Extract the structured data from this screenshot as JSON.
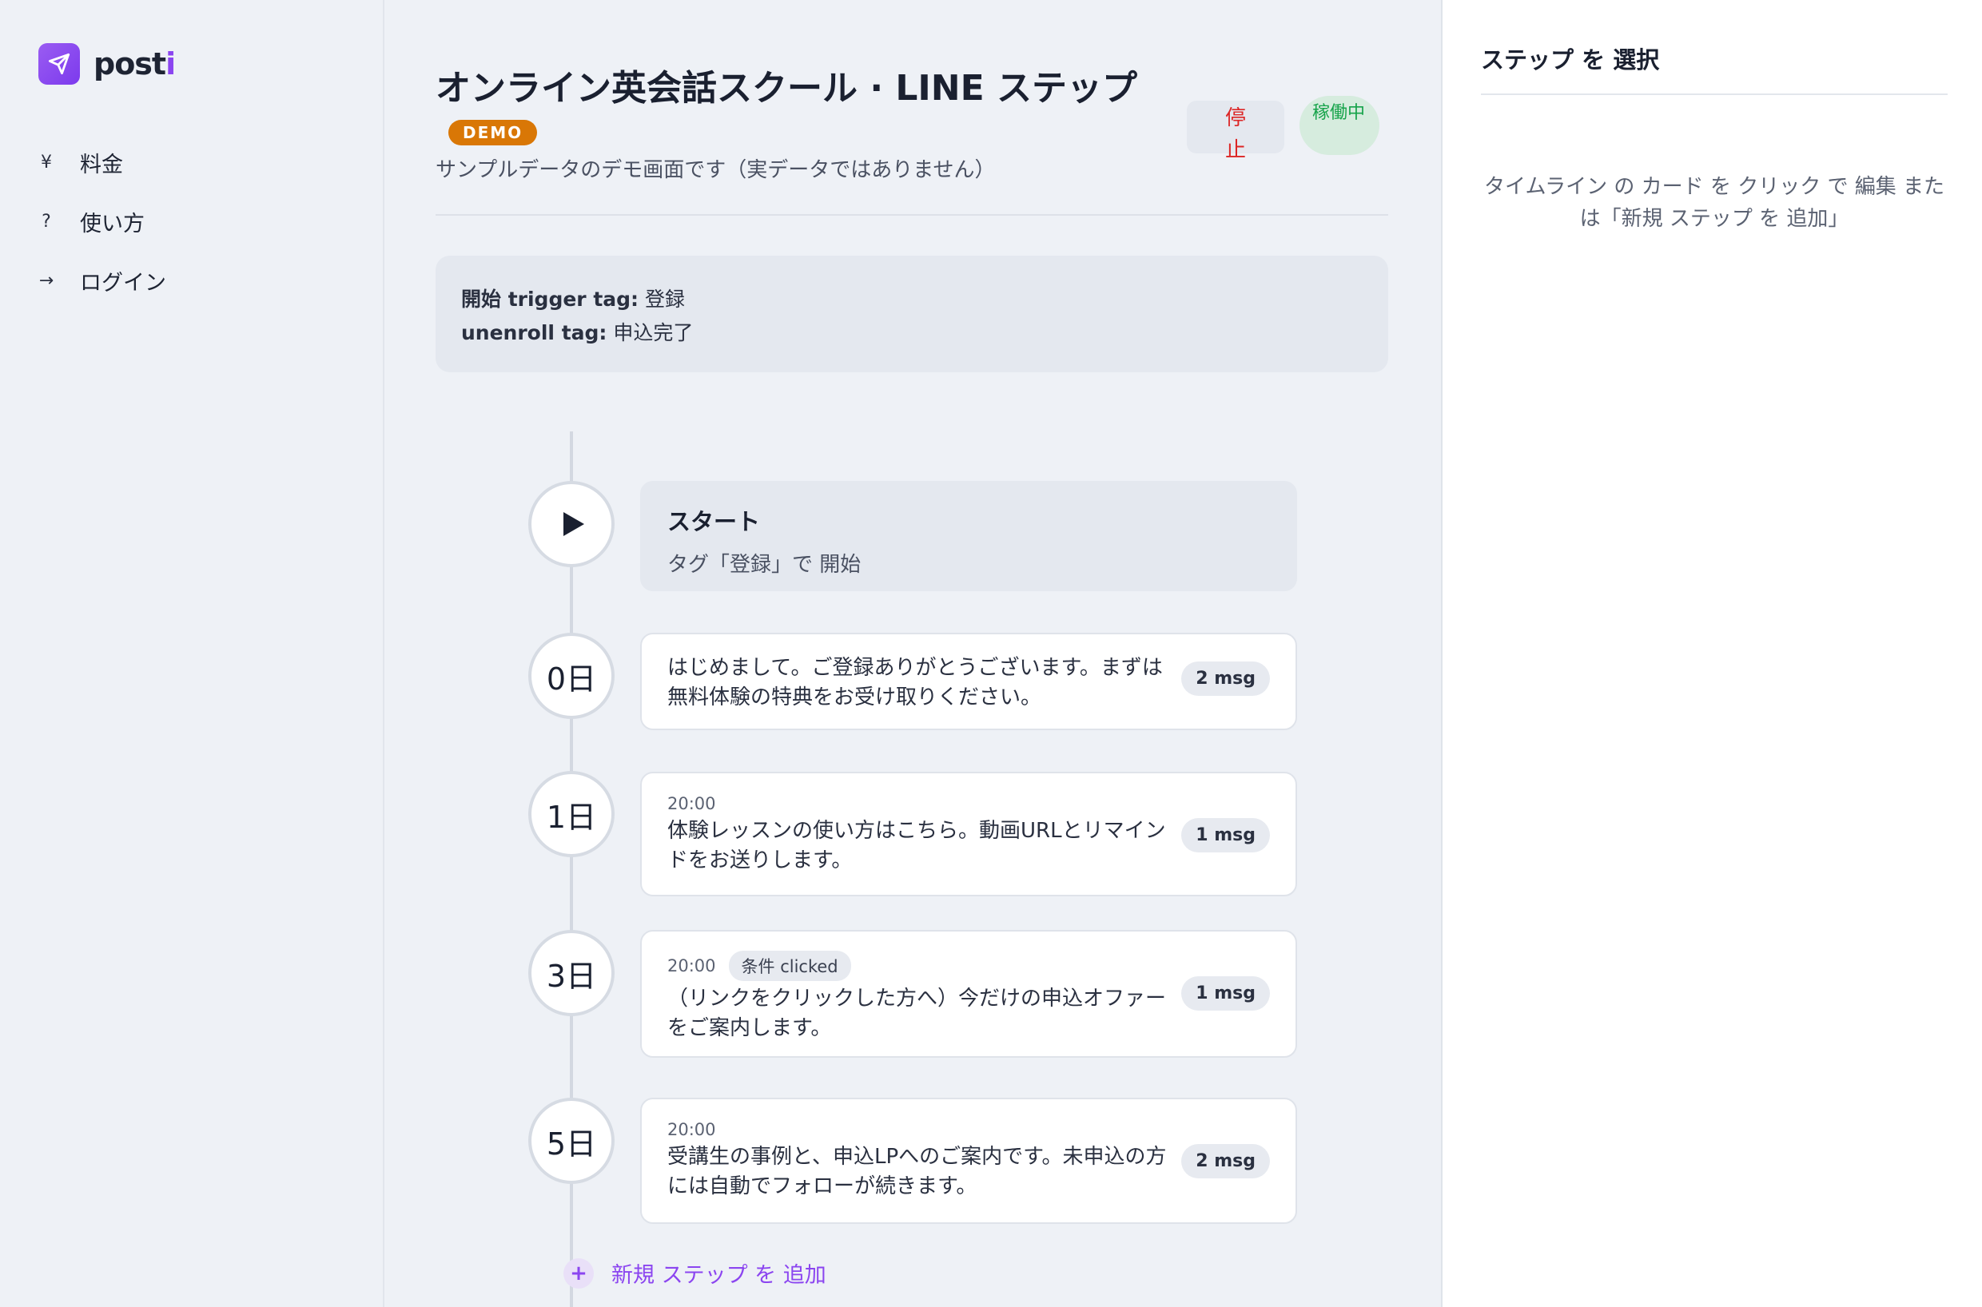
{
  "brand": {
    "name_main": "post",
    "name_accent": "i",
    "logo_icon": "paper-plane-icon",
    "color": "#8b45f0"
  },
  "nav": {
    "items": [
      {
        "icon": "¥",
        "icon_name": "yen-icon",
        "label": "料金"
      },
      {
        "icon": "?",
        "icon_name": "question-icon",
        "label": "使い方"
      },
      {
        "icon": "→",
        "icon_name": "arrow-right-icon",
        "label": "ログイン"
      }
    ]
  },
  "header": {
    "title": "オンライン英会話スクール · LINE ステップ",
    "badge": "DEMO",
    "subtitle": "サンプルデータのデモ画面です（実データではありません）",
    "stop_label": "停止",
    "active_label": "稼働中"
  },
  "tags": {
    "trigger_key": "開始 trigger tag:",
    "trigger_value": "登録",
    "unenroll_key": "unenroll tag:",
    "unenroll_value": "申込完了"
  },
  "timeline": {
    "start": {
      "title": "スタート",
      "subtitle": "タグ「登録」で 開始"
    },
    "steps": [
      {
        "day": "0日",
        "time": "",
        "condition": "",
        "text": "はじめまして。ご登録ありがとうございます。まずは無料体験の特典をお受け取りください。",
        "msg": "2 msg"
      },
      {
        "day": "1日",
        "time": "20:00",
        "condition": "",
        "text": "体験レッスンの使い方はこちら。動画URLとリマインドをお送りします。",
        "msg": "1 msg"
      },
      {
        "day": "3日",
        "time": "20:00",
        "condition": "条件 clicked",
        "text": "（リンクをクリックした方へ）今だけの申込オファーをご案内します。",
        "msg": "1 msg"
      },
      {
        "day": "5日",
        "time": "20:00",
        "condition": "",
        "text": "受講生の事例と、申込LPへのご案内です。未申込の方には自動でフォローが続きます。",
        "msg": "2 msg"
      }
    ],
    "add_label": "新規 ステップ を 追加"
  },
  "right_panel": {
    "title": "ステップ を 選択",
    "hint": "タイムライン の カード を クリック で 編集 または「新規 ステップ を 追加」"
  },
  "colors": {
    "accent": "#8b45f0",
    "stop": "#dc2626",
    "active": "#16a34a",
    "demo": "#d97706"
  }
}
